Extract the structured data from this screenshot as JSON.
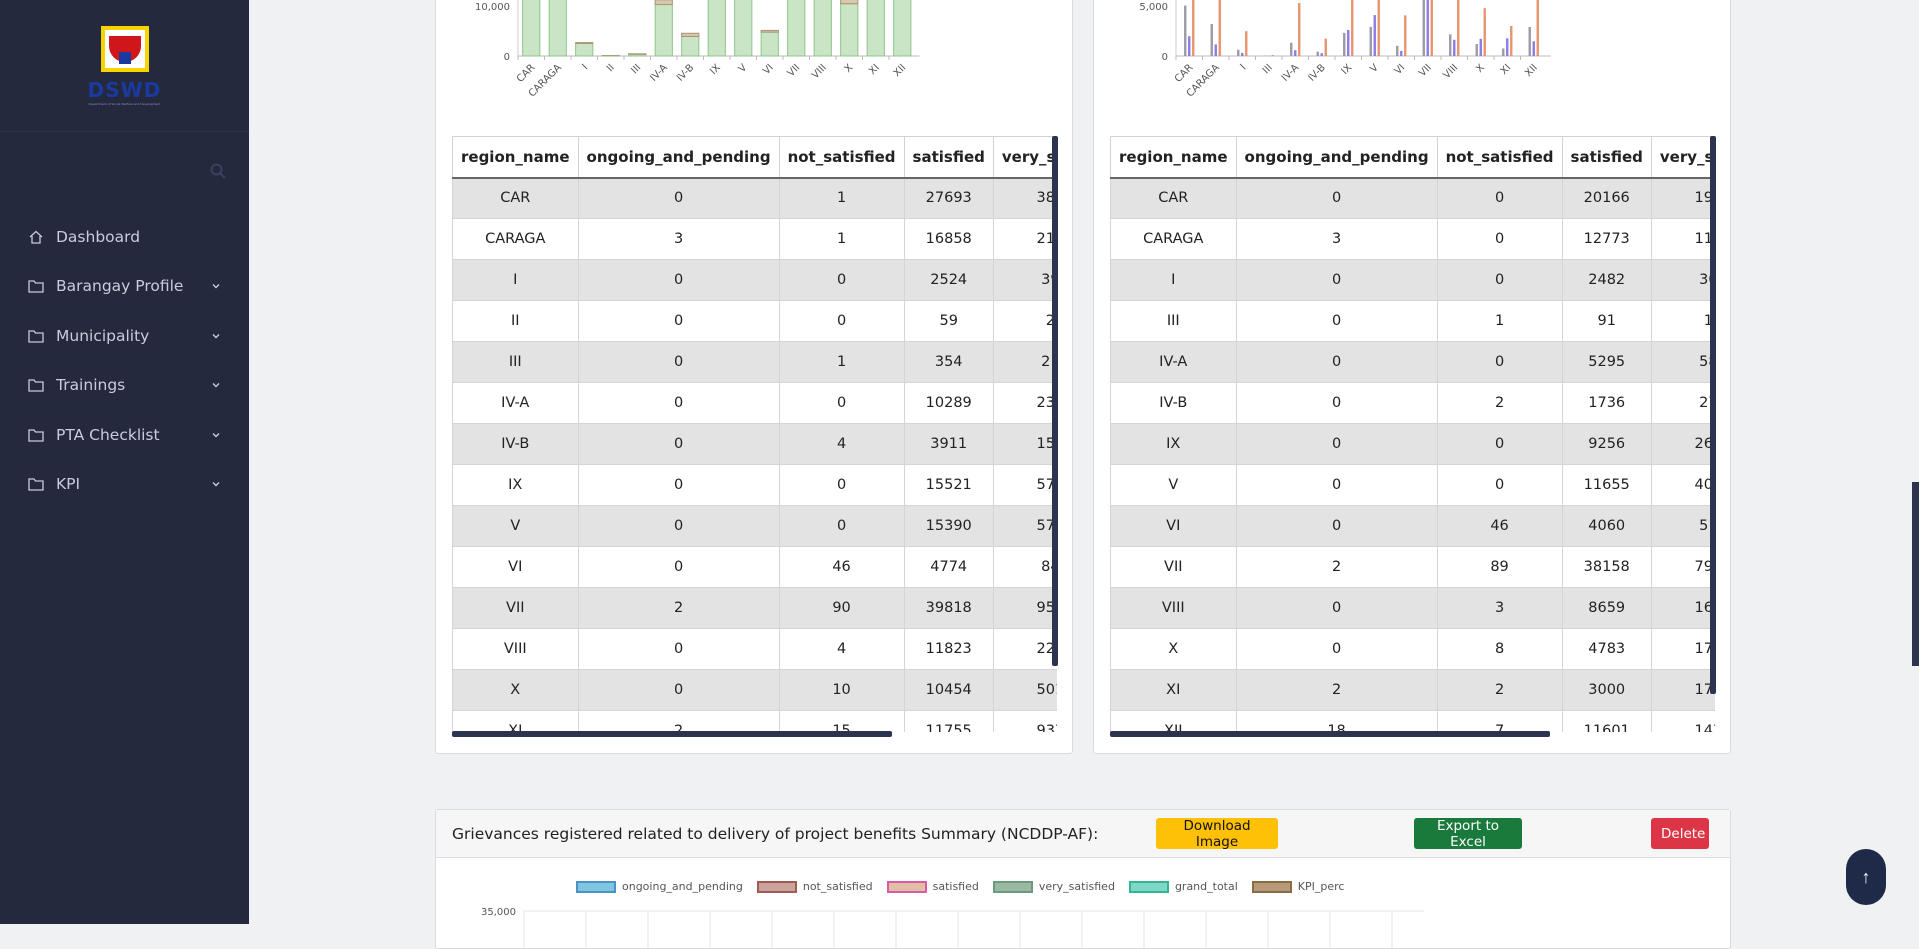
{
  "sidebar": {
    "logo_text": "DSWD",
    "logo_tag": "Department of Social Welfare and Development",
    "search_placeholder": "",
    "items": [
      {
        "label": "Dashboard",
        "has_children": false
      },
      {
        "label": "Barangay Profile",
        "has_children": true
      },
      {
        "label": "Municipality",
        "has_children": true
      },
      {
        "label": "Trainings",
        "has_children": true
      },
      {
        "label": "PTA Checklist",
        "has_children": true
      },
      {
        "label": "KPI",
        "has_children": true
      }
    ]
  },
  "colors": {
    "sidebar_bg": "#24293d",
    "bar_green_fill": "#c9e5c6",
    "bar_tan_fill": "#d8c8b0",
    "bar_blue": "#8e7be3",
    "bar_orange": "#e8956e",
    "download_btn": "#ffc107",
    "excel_btn": "#1a7a3c",
    "delete_btn": "#dc3545"
  },
  "chart_data": [
    {
      "type": "bar",
      "categories": [
        "CAR",
        "CARAGA",
        "I",
        "II",
        "III",
        "IV-A",
        "IV-B",
        "IX",
        "V",
        "VI",
        "VII",
        "VIII",
        "X",
        "XI",
        "XII"
      ],
      "yticks": [
        "10,000",
        "0"
      ],
      "series": [
        {
          "name": "satisfied",
          "values": [
            27693,
            16858,
            2524,
            59,
            354,
            10289,
            3911,
            15521,
            15390,
            4774,
            39818,
            11823,
            10454,
            11755,
            12000
          ]
        },
        {
          "name": "very_satisfied",
          "values": [
            3837,
            2170,
            391,
            23,
            219,
            2372,
            1585,
            5755,
            5733,
            841,
            9559,
            2249,
            5010,
            9377,
            2000
          ]
        }
      ]
    },
    {
      "type": "bar",
      "categories": [
        "CAR",
        "CARAGA",
        "I",
        "III",
        "IV-A",
        "IV-B",
        "IX",
        "V",
        "VI",
        "VII",
        "VIII",
        "X",
        "XI",
        "XII"
      ],
      "yticks": [
        "5,000",
        "0"
      ],
      "series": [
        {
          "name": "satisfied",
          "values": [
            20166,
            12773,
            2482,
            91,
            5295,
            1736,
            9256,
            11655,
            4060,
            38158,
            8659,
            4783,
            3000,
            11601
          ]
        },
        {
          "name": "very_satisfied",
          "values": [
            1977,
            1157,
            307,
            14,
            582,
            279,
            2602,
            4086,
            510,
            7950,
            1620,
            1716,
            1769,
            1470
          ]
        }
      ]
    },
    {
      "type": "bar",
      "title": "",
      "legend": [
        "ongoing_and_pending",
        "not_satisfied",
        "satisfied",
        "very_satisfied",
        "grand_total",
        "KPI_perc"
      ],
      "yticks": [
        "35,000"
      ],
      "categories": [],
      "series": []
    }
  ],
  "table_left": {
    "headers": [
      "region_name",
      "ongoing_and_pending",
      "not_satisfied",
      "satisfied",
      "very_satisfie"
    ],
    "rows": [
      [
        "CAR",
        "0",
        "1",
        "27693",
        "3837"
      ],
      [
        "CARAGA",
        "3",
        "1",
        "16858",
        "2170"
      ],
      [
        "I",
        "0",
        "0",
        "2524",
        "391"
      ],
      [
        "II",
        "0",
        "0",
        "59",
        "23"
      ],
      [
        "III",
        "0",
        "1",
        "354",
        "219"
      ],
      [
        "IV-A",
        "0",
        "0",
        "10289",
        "2372"
      ],
      [
        "IV-B",
        "0",
        "4",
        "3911",
        "1585"
      ],
      [
        "IX",
        "0",
        "0",
        "15521",
        "5755"
      ],
      [
        "V",
        "0",
        "0",
        "15390",
        "5733"
      ],
      [
        "VI",
        "0",
        "46",
        "4774",
        "841"
      ],
      [
        "VII",
        "2",
        "90",
        "39818",
        "9559"
      ],
      [
        "VIII",
        "0",
        "4",
        "11823",
        "2249"
      ],
      [
        "X",
        "0",
        "10",
        "10454",
        "5010"
      ],
      [
        "XI",
        "2",
        "15",
        "11755",
        "9377"
      ]
    ]
  },
  "table_right": {
    "headers": [
      "region_name",
      "ongoing_and_pending",
      "not_satisfied",
      "satisfied",
      "very_satisfie"
    ],
    "rows": [
      [
        "CAR",
        "0",
        "0",
        "20166",
        "1977"
      ],
      [
        "CARAGA",
        "3",
        "0",
        "12773",
        "1157"
      ],
      [
        "I",
        "0",
        "0",
        "2482",
        "307"
      ],
      [
        "III",
        "0",
        "1",
        "91",
        "14"
      ],
      [
        "IV-A",
        "0",
        "0",
        "5295",
        "582"
      ],
      [
        "IV-B",
        "0",
        "2",
        "1736",
        "279"
      ],
      [
        "IX",
        "0",
        "0",
        "9256",
        "2602"
      ],
      [
        "V",
        "0",
        "0",
        "11655",
        "4086"
      ],
      [
        "VI",
        "0",
        "46",
        "4060",
        "510"
      ],
      [
        "VII",
        "2",
        "89",
        "38158",
        "7950"
      ],
      [
        "VIII",
        "0",
        "3",
        "8659",
        "1620"
      ],
      [
        "X",
        "0",
        "8",
        "4783",
        "1716"
      ],
      [
        "XI",
        "2",
        "2",
        "3000",
        "1769"
      ],
      [
        "XII",
        "18",
        "7",
        "11601",
        "1470"
      ]
    ]
  },
  "bottom_card": {
    "title": "Grievances registered related to delivery of project benefits Summary (NCDDP-AF):",
    "download_label": "Download Image",
    "excel_label": "Export to Excel",
    "delete_label": "Delete",
    "legend_colors": [
      "#7fc5de",
      "#c9a49c",
      "#e0bfa6",
      "#9ab8a2",
      "#7dd8c7",
      "#b89a78"
    ],
    "legend_borders": [
      "#4a93c8",
      "#a35a53",
      "#d85ba8",
      "#6b9a7e",
      "#33b593",
      "#8a6a40"
    ]
  },
  "to_top_label": "↑"
}
